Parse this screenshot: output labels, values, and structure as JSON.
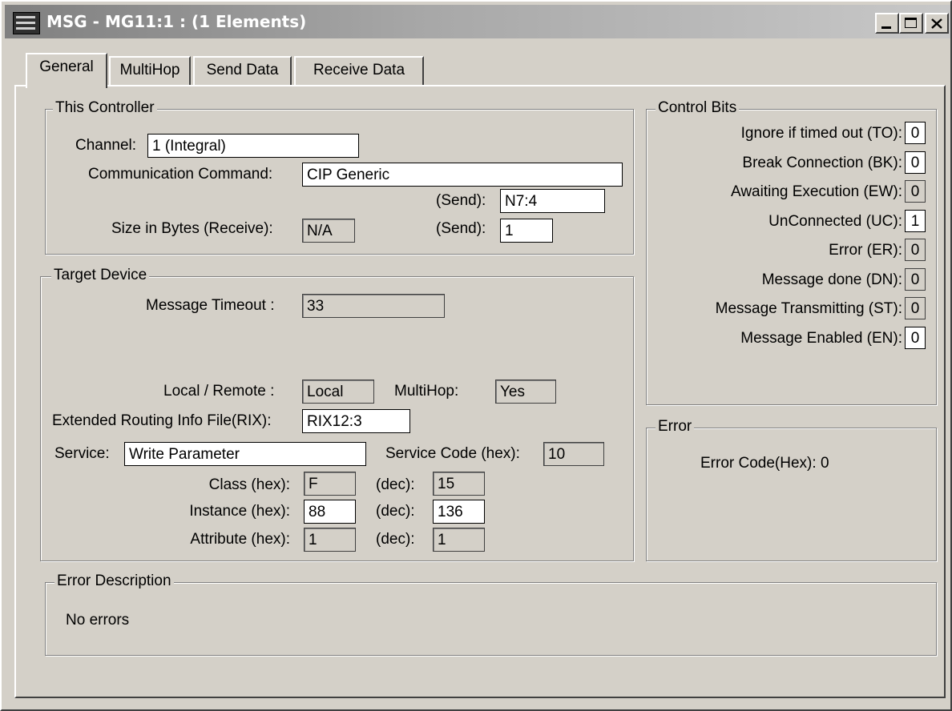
{
  "window": {
    "title": "MSG - MG11:1 : (1 Elements)"
  },
  "tabs": [
    "General",
    "MultiHop",
    "Send Data",
    "Receive Data"
  ],
  "this_controller": {
    "legend": "This Controller",
    "channel_label": "Channel:",
    "channel_value": "1 (Integral)",
    "command_label": "Communication Command:",
    "command_value": "CIP Generic",
    "send_label": "(Send):",
    "send_value": "N7:4",
    "size_label": "Size in Bytes (Receive):",
    "size_receive_value": "N/A",
    "size_send_label": "(Send):",
    "size_send_value": "1"
  },
  "target_device": {
    "legend": "Target Device",
    "timeout_label": "Message Timeout :",
    "timeout_value": "33",
    "local_remote_label": "Local / Remote :",
    "local_remote_value": "Local",
    "multihop_label": "MultiHop:",
    "multihop_value": "Yes",
    "rix_label": "Extended Routing Info File(RIX):",
    "rix_value": "RIX12:3",
    "service_label": "Service:",
    "service_value": "Write Parameter",
    "service_code_label": "Service Code (hex):",
    "service_code_value": "10",
    "class_label": "Class (hex):",
    "class_hex": "F",
    "class_dec_label": "(dec):",
    "class_dec": "15",
    "instance_label": "Instance (hex):",
    "instance_hex": "88",
    "instance_dec_label": "(dec):",
    "instance_dec": "136",
    "attribute_label": "Attribute (hex):",
    "attribute_hex": "1",
    "attribute_dec_label": "(dec):",
    "attribute_dec": "1"
  },
  "control_bits": {
    "legend": "Control Bits",
    "items": [
      {
        "label": "Ignore if timed out (TO):",
        "value": "0",
        "editable": true
      },
      {
        "label": "Break Connection (BK):",
        "value": "0",
        "editable": true
      },
      {
        "label": "Awaiting Execution (EW):",
        "value": "0",
        "editable": false
      },
      {
        "label": "UnConnected (UC):",
        "value": "1",
        "editable": true
      },
      {
        "label": "Error (ER):",
        "value": "0",
        "editable": false
      },
      {
        "label": "Message done (DN):",
        "value": "0",
        "editable": false
      },
      {
        "label": "Message Transmitting (ST):",
        "value": "0",
        "editable": false
      },
      {
        "label": "Message Enabled (EN):",
        "value": "0",
        "editable": true
      }
    ]
  },
  "error": {
    "legend": "Error",
    "code_label": "Error Code(Hex):",
    "code_value": "0"
  },
  "error_description": {
    "legend": "Error Description",
    "text": "No errors"
  }
}
